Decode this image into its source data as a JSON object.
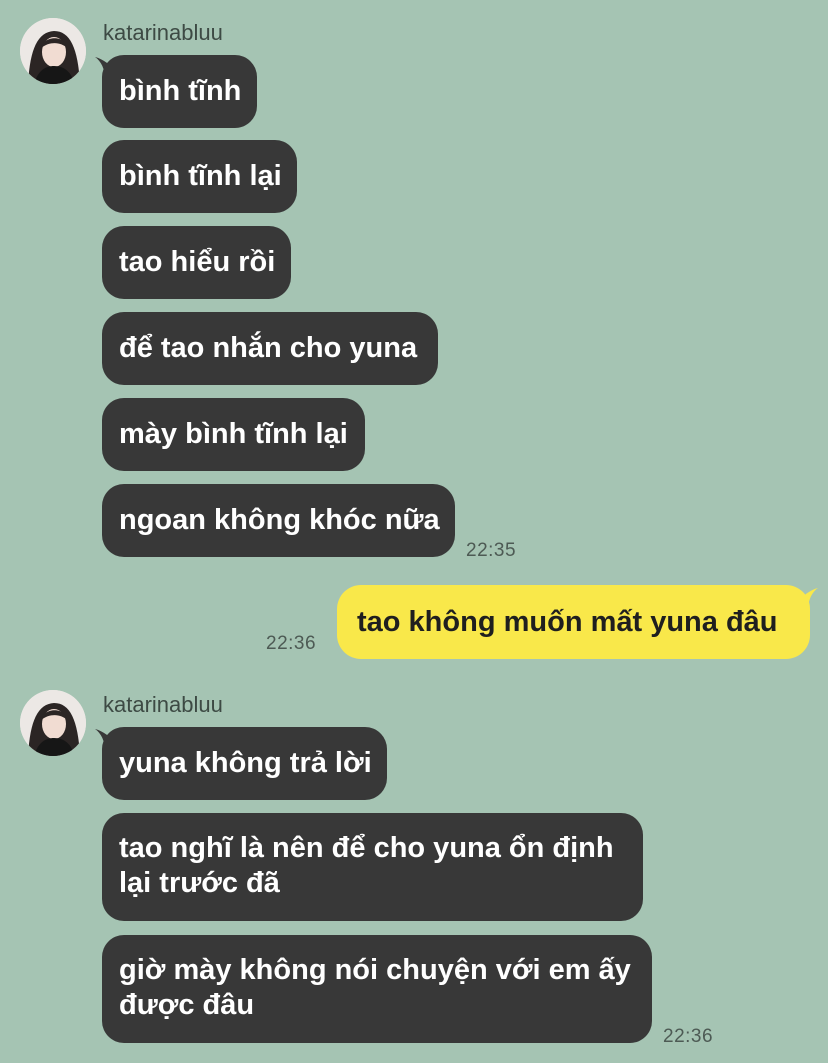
{
  "chat": {
    "groups": [
      {
        "sender": "katarinabluu",
        "messages": [
          "bình tĩnh",
          "bình tĩnh lại",
          "tao hiểu rồi",
          "để tao nhắn cho yuna",
          "mày bình tĩnh lại",
          "ngoan không khóc nữa"
        ],
        "time": "22:35"
      },
      {
        "outgoing": true,
        "messages": [
          "tao không muốn mất yuna đâu"
        ],
        "time": "22:36"
      },
      {
        "sender": "katarinabluu",
        "messages": [
          "yuna không trả lời",
          "tao nghĩ là nên để cho yuna ổn định lại trước đã",
          "giờ mày không nói chuyện với em ấy được đâu"
        ],
        "time": "22:36"
      }
    ]
  },
  "colors": {
    "background": "#a5c4b3",
    "incoming_bubble": "#383838",
    "outgoing_bubble": "#f9e84a"
  },
  "icons": {
    "avatar": "profile-photo"
  }
}
